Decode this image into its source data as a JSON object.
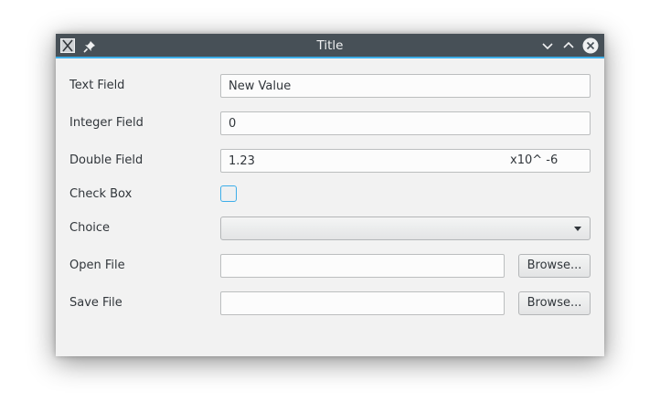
{
  "window": {
    "title": "Title"
  },
  "form": {
    "text_field": {
      "label": "Text Field",
      "value": "New Value"
    },
    "integer_field": {
      "label": "Integer Field",
      "value": "0"
    },
    "double_field": {
      "label": "Double Field",
      "value": "1.23",
      "exponent_label": "x10^ -6"
    },
    "check_box": {
      "label": "Check Box",
      "checked": false
    },
    "choice": {
      "label": "Choice",
      "selected": ""
    },
    "open_file": {
      "label": "Open File",
      "value": "",
      "browse_label": "Browse..."
    },
    "save_file": {
      "label": "Save File",
      "value": "",
      "browse_label": "Browse..."
    }
  },
  "colors": {
    "titlebar": "#475057",
    "accent": "#3daee9",
    "window_bg": "#f2f2f2",
    "text": "#31363b"
  },
  "icons": [
    "app-icon",
    "pin-icon",
    "minimize-icon",
    "maximize-icon",
    "close-icon",
    "chevron-down-icon"
  ]
}
